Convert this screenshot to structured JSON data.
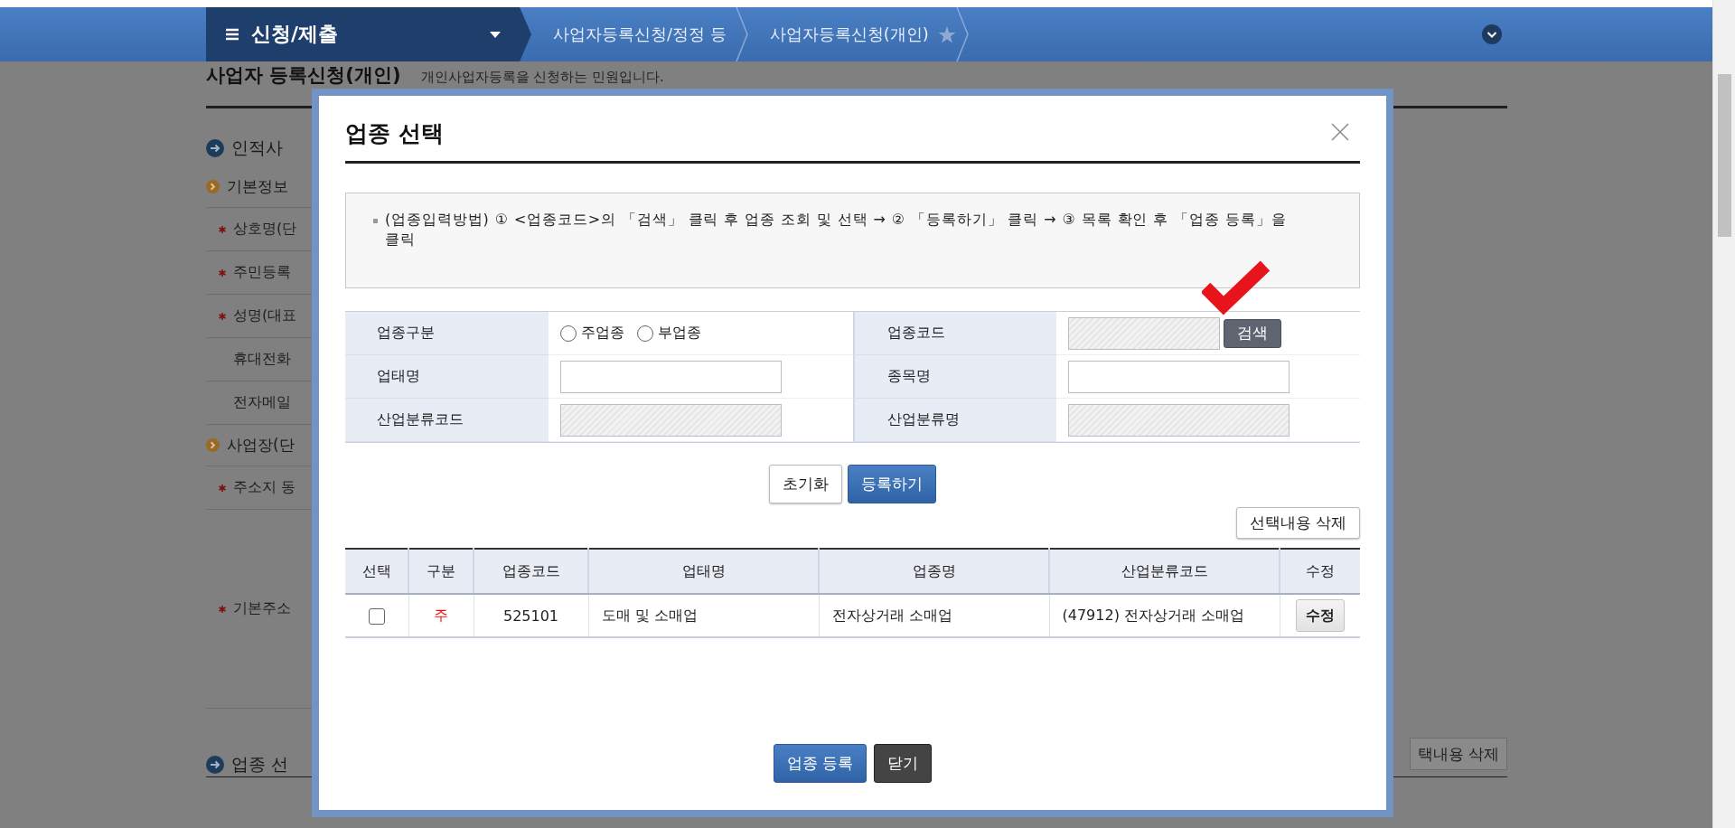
{
  "nav": {
    "menu_title": "신청/제출",
    "breadcrumbs": [
      {
        "label": "사업자등록신청/정정 등",
        "starred": false
      },
      {
        "label": "사업자등록신청(개인)",
        "starred": true
      }
    ]
  },
  "page": {
    "title": "사업자 등록신청(개인)",
    "subtitle": "개인사업자등록을 신청하는 민원입니다.",
    "items": [
      {
        "kind": "section",
        "label": "인적사"
      },
      {
        "kind": "subsection",
        "label": "기본정보"
      },
      {
        "kind": "field",
        "label": "상호명(단",
        "required": true
      },
      {
        "kind": "field",
        "label": "주민등록",
        "required": true
      },
      {
        "kind": "field",
        "label": "성명(대표",
        "required": true
      },
      {
        "kind": "field",
        "label": "휴대전화",
        "required": false
      },
      {
        "kind": "field",
        "label": "전자메일",
        "required": false
      },
      {
        "kind": "subsection",
        "label": "사업장(단"
      },
      {
        "kind": "field",
        "label": "주소지 동",
        "required": true
      },
      {
        "kind": "address",
        "label": "기본주소",
        "required": true
      },
      {
        "kind": "section",
        "label": "업종 선"
      }
    ],
    "bottom_button": "택내용 삭제"
  },
  "modal": {
    "title": "업종 선택",
    "instruction": "(업종입력방법) ① <업종코드>의 「검색」 클릭 후 업종 조회 및 선택 → ② 「등록하기」 클릭 → ③ 목록 확인 후 「업종 등록」을 클릭",
    "form": [
      {
        "label": "업종구분",
        "kind": "radio",
        "options": [
          {
            "label": "주업종",
            "selected": false
          },
          {
            "label": "부업종",
            "selected": false
          }
        ]
      },
      {
        "label": "업종코드",
        "kind": "search",
        "disabled": true,
        "button": "검색"
      },
      {
        "label": "업태명",
        "kind": "text",
        "disabled": false
      },
      {
        "label": "종목명",
        "kind": "text",
        "disabled": false
      },
      {
        "label": "산업분류코드",
        "kind": "text",
        "disabled": true
      },
      {
        "label": "산업분류명",
        "kind": "text",
        "disabled": true
      }
    ],
    "form_buttons": [
      {
        "label": "초기화",
        "kind": "secondary"
      },
      {
        "label": "등록하기",
        "kind": "primary"
      }
    ],
    "delete_button": "선택내용 삭제",
    "table": {
      "columns": [
        "선택",
        "구분",
        "업종코드",
        "업태명",
        "업종명",
        "산업분류코드",
        "수정"
      ],
      "rows": [
        {
          "checked": false,
          "category": "주",
          "code": "525101",
          "business_type": "도매 및 소매업",
          "item": "전자상거래 소매업",
          "industry_code": "(47912) 전자상거래 소매업",
          "edit_button": "수정"
        }
      ]
    },
    "footer_buttons": [
      {
        "label": "업종 등록",
        "kind": "primary"
      },
      {
        "label": "닫기",
        "kind": "dark"
      }
    ]
  }
}
